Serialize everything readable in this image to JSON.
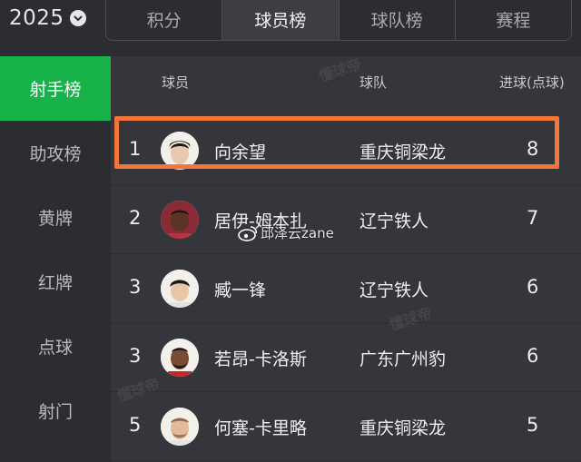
{
  "header": {
    "year": "2025",
    "tabs": [
      {
        "label": "积分",
        "active": false
      },
      {
        "label": "球员榜",
        "active": true
      },
      {
        "label": "球队榜",
        "active": false
      },
      {
        "label": "赛程",
        "active": false
      }
    ]
  },
  "sidebar": {
    "items": [
      {
        "label": "射手榜",
        "active": true
      },
      {
        "label": "助攻榜",
        "active": false
      },
      {
        "label": "黄牌",
        "active": false
      },
      {
        "label": "红牌",
        "active": false
      },
      {
        "label": "点球",
        "active": false
      },
      {
        "label": "射门",
        "active": false
      }
    ]
  },
  "table": {
    "headers": {
      "player": "球员",
      "team": "球队",
      "goals": "进球(点球)"
    },
    "rows": [
      {
        "rank": "1",
        "name": "向余望",
        "team": "重庆铜梁龙",
        "goals": "8"
      },
      {
        "rank": "2",
        "name": "居伊-姆本扎",
        "team": "辽宁铁人",
        "goals": "7"
      },
      {
        "rank": "3",
        "name": "臧一锋",
        "team": "辽宁铁人",
        "goals": "6"
      },
      {
        "rank": "3",
        "name": "若昂-卡洛斯",
        "team": "广东广州豹",
        "goals": "6"
      },
      {
        "rank": "5",
        "name": "何塞-卡里略",
        "team": "重庆铜梁龙",
        "goals": "5"
      }
    ]
  },
  "overlay": {
    "weibo_handle": "邱泽云zane",
    "watermark": "懂球帝"
  },
  "colors": {
    "accent_green": "#18b24a",
    "highlight_orange": "#f5753a"
  }
}
